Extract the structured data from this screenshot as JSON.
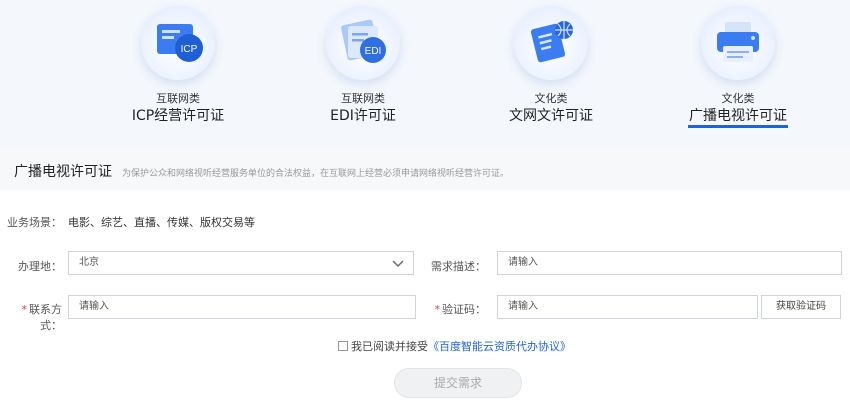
{
  "cards": [
    {
      "category": "互联网类",
      "name": "ICP经营许可证",
      "icon_text": "ICP",
      "icon": "icp-license-icon"
    },
    {
      "category": "互联网类",
      "name": "EDI许可证",
      "icon_text": "EDI",
      "icon": "edi-license-icon"
    },
    {
      "category": "文化类",
      "name": "文网文许可证",
      "icon_text": "",
      "icon": "document-globe-icon"
    },
    {
      "category": "文化类",
      "name": "广播电视许可证",
      "icon_text": "",
      "icon": "printer-icon"
    }
  ],
  "active_card_index": 3,
  "section": {
    "title": "广播电视许可证",
    "description": "为保护公众和网络视听经营服务单位的合法权益，在互联网上经营必须申请网络视听经营许可证。"
  },
  "form": {
    "scene_label": "业务场景：",
    "scene_value": "电影、综艺、直播、传媒、版权交易等",
    "location_label": "办理地：",
    "location_value": "北京",
    "need_label": "需求描述：",
    "need_placeholder": "请输入",
    "contact_label": "联系方式：",
    "contact_placeholder": "请输入",
    "code_label": "验证码：",
    "code_placeholder": "请输入",
    "get_code_button": "获取验证码",
    "agree_text": "我已阅读并接受",
    "agree_link": "《百度智能云资质代办协议》",
    "submit_label": "提交需求"
  },
  "colors": {
    "accent": "#1f63d8",
    "required": "#e63b3b"
  }
}
